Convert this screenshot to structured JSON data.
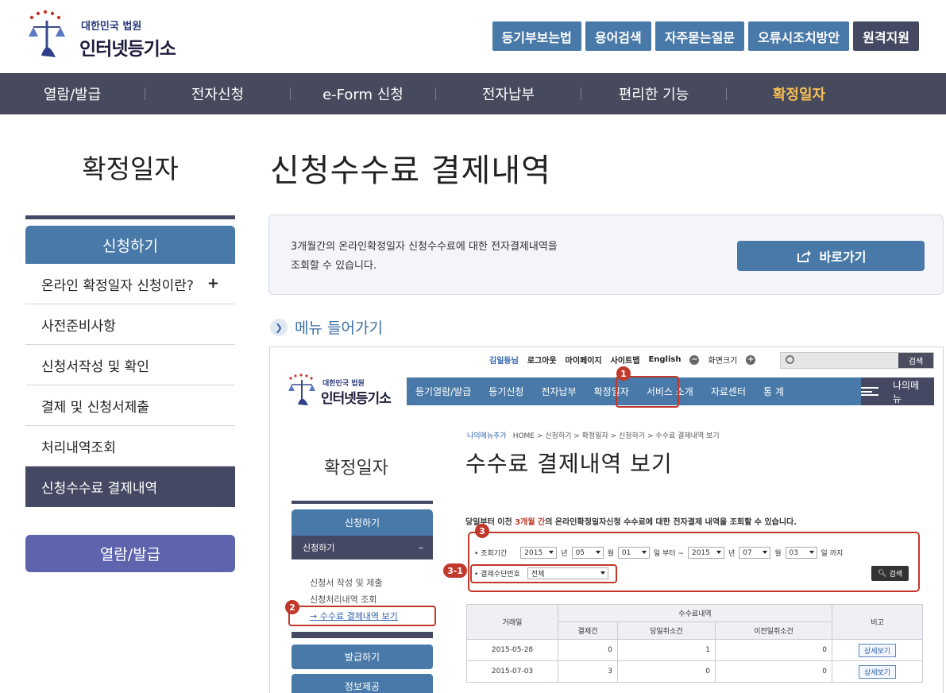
{
  "header": {
    "logo_sub": "대한민국 법원",
    "logo_main": "인터넷등기소",
    "buttons": [
      "등기부보는법",
      "용어검색",
      "자주묻는질문",
      "오류시조치방안",
      "원격지원"
    ]
  },
  "nav": {
    "items": [
      "열람/발급",
      "전자신청",
      "e-Form 신청",
      "전자납부",
      "편리한 기능",
      "확정일자"
    ],
    "active_index": 5
  },
  "sidebar": {
    "title": "확정일자",
    "section": "신청하기",
    "items": [
      "온라인 확정일자 신청이란?",
      "사전준비사항",
      "신청서작성 및 확인",
      "결제 및 신청서제출",
      "처리내역조회",
      "신청수수료 결제내역"
    ],
    "expand_symbol": "+",
    "button2": "열람/발급"
  },
  "main": {
    "title": "신청수수료 결제내역",
    "info_line1": "3개월간의 온라인확정일자 신청수수료에 대한 전자결제내역을",
    "info_line2": "조회할 수 있습니다.",
    "go_button": "바로가기",
    "menu_enter": "메뉴 들어가기"
  },
  "screenshot": {
    "top_links": [
      "김일등님",
      "로그아웃",
      "마이페이지",
      "사이트맵",
      "English",
      "화면크기"
    ],
    "search_button": "검색",
    "logo_sub": "대한민국 법원",
    "logo_main": "인터넷등기소",
    "nav": [
      "등기열람/발급",
      "등기신청",
      "전자납부",
      "확정일자",
      "서비스 소개",
      "자료센터",
      "통 계"
    ],
    "my_menu": "나의메뉴",
    "breadcrumb": "나의메뉴추가",
    "breadcrumb_path": "HOME > 신청하기 > 확정일자 > 신청하기 > 수수료 결제내역 보기",
    "page_title": "수수료 결제내역 보기",
    "side_title": "확정일자",
    "side_head": "신청하기",
    "side_sub": "신청하기",
    "side_sub_symbol": "–",
    "side_links": [
      "신청서 작성 및 제출",
      "신청처리내역 조회",
      "→ 수수료 결제내역 보기"
    ],
    "side_buttons": [
      "발급하기",
      "정보제공"
    ],
    "desc_pre": "당일부터 이전 ",
    "desc_red": "3개월 간",
    "desc_post": "의 온라인확정일자신청 수수료에 대한 전자결제 내역을 조회할 수 있습니다.",
    "form": {
      "period_label": "• 조회기간",
      "from_year": "2015",
      "from_month": "05",
      "from_day": "01",
      "to_year": "2015",
      "to_month": "07",
      "to_day": "03",
      "year_unit": "년",
      "month_unit": "월",
      "from_day_unit": "일 부터 ~",
      "to_day_unit": "일 까지",
      "payment_label": "• 결제수단번호",
      "payment_value": "전체",
      "search_button": "검색"
    },
    "badges": [
      "1",
      "2",
      "3",
      "3-1"
    ],
    "table": {
      "headers": {
        "date": "거래일",
        "group": "수수료내역",
        "note": "비고"
      },
      "sub_headers": [
        "결제건",
        "당일취소건",
        "이전일취소건"
      ],
      "rows": [
        {
          "date": "2015-05-28",
          "paid": "0",
          "same_day_cancel": "1",
          "prev_cancel": "0",
          "note": "상세보기"
        },
        {
          "date": "2015-07-03",
          "paid": "3",
          "same_day_cancel": "0",
          "prev_cancel": "0",
          "note": "상세보기"
        }
      ]
    }
  },
  "colors": {
    "blue": "#4979a8",
    "dark": "#454862",
    "accent": "#f6be55",
    "highlight": "#c0392b"
  }
}
